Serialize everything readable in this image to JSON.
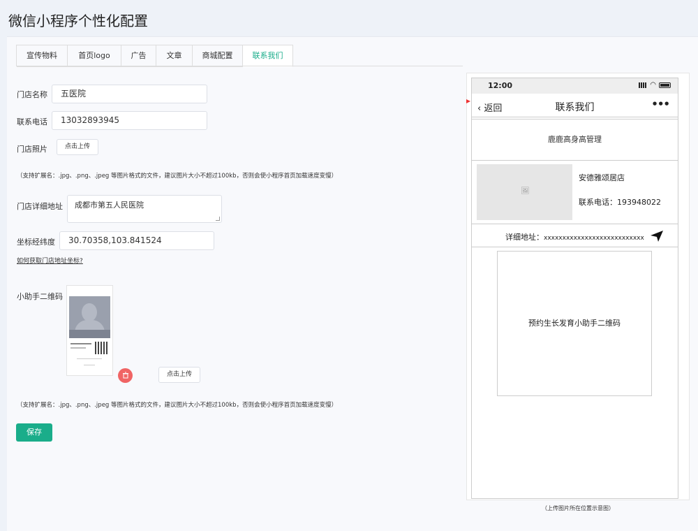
{
  "page": {
    "title": "微信小程序个性化配置"
  },
  "tabs": [
    {
      "label": "宣传物料",
      "active": false
    },
    {
      "label": "首页logo",
      "active": false
    },
    {
      "label": "广告",
      "active": false
    },
    {
      "label": "文章",
      "active": false
    },
    {
      "label": "商城配置",
      "active": false
    },
    {
      "label": "联系我们",
      "active": true
    }
  ],
  "form": {
    "store_name": {
      "label": "门店名称",
      "value": "五医院"
    },
    "phone": {
      "label": "联系电话",
      "value": "13032893945"
    },
    "photo": {
      "label": "门店照片",
      "upload_label": "点击上传"
    },
    "hint": "（支持扩展名：.jpg、.png、.jpeg 等图片格式的文件，建议图片大小不超过100kb，否则会使小程序首页加载速度变慢）",
    "address": {
      "label": "门店详细地址",
      "value": "成都市第五人民医院"
    },
    "coords": {
      "label": "坐标经纬度",
      "value": "30.70358,103.841524"
    },
    "coords_link": "如何获取门店地址坐标?",
    "qrcode": {
      "label": "小助手二维码",
      "upload_label": "点击上传"
    },
    "hint2": "（支持扩展名：.jpg、.png、.jpeg 等图片格式的文件，建议图片大小不超过100kb，否则会使小程序首页加载速度变慢）",
    "save_label": "保存"
  },
  "preview": {
    "status_time": "12:00",
    "back_label": "返回",
    "nav_title": "联系我们",
    "more_label": "•••",
    "org_name": "鹿鹿高身高管理",
    "store_name": "安德雅颂居店",
    "store_phone": "联系电话：193948022",
    "address_label": "详细地址：",
    "address_value": "xxxxxxxxxxxxxxxxxxxxxxxxxxx",
    "qr_text": "预约生长发育小助手二维码",
    "caption": "（上传图片所在位置示意图）"
  },
  "icons": {
    "back": "chevron-left-icon",
    "more": "more-dots-icon",
    "image_placeholder": "image-icon",
    "navigate": "navigation-arrow-icon",
    "delete": "trash-icon"
  },
  "colors": {
    "accent": "#1aad8a",
    "danger": "#f06464",
    "marker": "#e33333"
  }
}
